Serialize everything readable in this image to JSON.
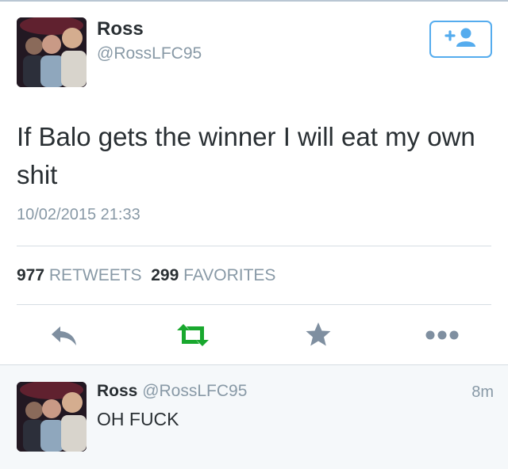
{
  "colors": {
    "accent": "#55acee",
    "retweet": "#19a82e",
    "icon_gray": "#7f8fa0",
    "text": "#292f33",
    "muted": "#8899a6"
  },
  "tweet": {
    "author_name": "Ross",
    "author_handle": "@RossLFC95",
    "text": "If Balo gets the winner I will eat my own shit",
    "timestamp": "10/02/2015 21:33",
    "retweets_count": "977",
    "retweets_label": "RETWEETS",
    "favorites_count": "299",
    "favorites_label": "FAVORITES",
    "follow_icon": "follow-user-icon"
  },
  "actions": [
    {
      "name": "reply",
      "icon": "reply-icon"
    },
    {
      "name": "retweet",
      "icon": "retweet-icon"
    },
    {
      "name": "favorite",
      "icon": "star-icon"
    },
    {
      "name": "more",
      "icon": "more-dots-icon"
    }
  ],
  "reply": {
    "author_name": "Ross",
    "author_handle": "@RossLFC95",
    "time": "8m",
    "text": "OH FUCK"
  }
}
